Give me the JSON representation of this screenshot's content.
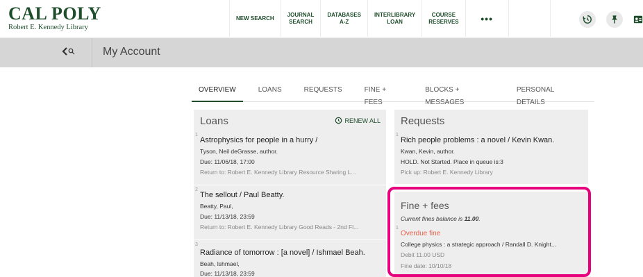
{
  "header": {
    "logo_main": "CAL POLY",
    "logo_sub": "Robert E. Kennedy Library",
    "nav": [
      {
        "line1": "NEW SEARCH",
        "line2": ""
      },
      {
        "line1": "JOURNAL",
        "line2": "SEARCH"
      },
      {
        "line1": "DATABASES",
        "line2": "A-Z"
      },
      {
        "line1": "INTERLIBRARY",
        "line2": "LOAN"
      },
      {
        "line1": "COURSE",
        "line2": "RESERVES"
      }
    ],
    "more_label": "•••",
    "icons": [
      "history-icon",
      "pin-icon",
      "user-card-icon"
    ]
  },
  "account_bar": {
    "title": "My Account"
  },
  "tabs": [
    "OVERVIEW",
    "LOANS",
    "REQUESTS",
    "FINE + FEES",
    "BLOCKS + MESSAGES",
    "PERSONAL DETAILS"
  ],
  "active_tab": "OVERVIEW",
  "loans": {
    "heading": "Loans",
    "renew_all": "RENEW ALL",
    "items": [
      {
        "num": "1",
        "title": "Astrophysics for people in a hurry /",
        "author": "Tyson, Neil deGrasse, author.",
        "due": "Due: 11/06/18, 17:00",
        "return": "Return to: Robert E. Kennedy Library Resource Sharing L..."
      },
      {
        "num": "2",
        "title": "The sellout / Paul Beatty.",
        "author": "Beatty, Paul,",
        "due": "Due: 11/13/18, 23:59",
        "return": "Return to: Robert E. Kennedy Library Good Reads - 2nd Fl..."
      },
      {
        "num": "3",
        "title": "Radiance of tomorrow : [a novel] / Ishmael Beah.",
        "author": "Beah, Ishmael,",
        "due": "Due: 11/13/18, 23:59",
        "return": ""
      }
    ]
  },
  "requests": {
    "heading": "Requests",
    "items": [
      {
        "num": "1",
        "title": "Rich people problems : a novel / Kevin Kwan.",
        "author": "Kwan, Kevin, author.",
        "status": "HOLD. Not Started. Place in queue is:3",
        "pickup": "Pick up: Robert E. Kennedy Library"
      }
    ]
  },
  "fines": {
    "heading": "Fine + fees",
    "balance_prefix": "Current fines balance is ",
    "balance_value": "11.00",
    "balance_suffix": ".",
    "items": [
      {
        "num": "1",
        "type": "Overdue fine",
        "title": "College physics : a strategic approach / Randall D. Knight...",
        "debit": "Debit 11.00 USD",
        "date": "Fine date: 10/10/18"
      }
    ]
  },
  "colors": {
    "brand": "#1e4d2b",
    "highlight": "#e6007e",
    "fine_type": "#e8604c"
  }
}
